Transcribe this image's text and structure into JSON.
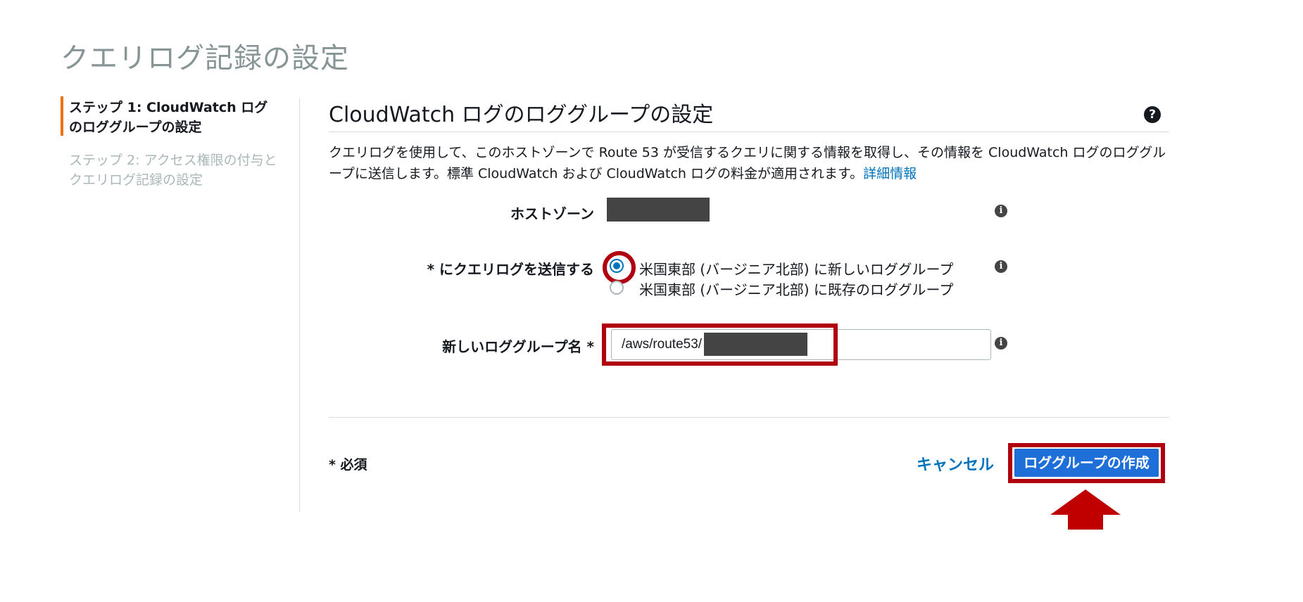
{
  "page": {
    "title": "クエリログ記録の設定"
  },
  "steps": [
    {
      "label": "ステップ 1: CloudWatch ログのロググループの設定",
      "active": true
    },
    {
      "label": "ステップ 2: アクセス権限の付与とクエリログ記録の設定",
      "active": false
    }
  ],
  "section": {
    "title": "CloudWatch ログのロググループの設定",
    "description": "クエリログを使用して、このホストゾーンで Route 53 が受信するクエリに関する情報を取得し、その情報を CloudWatch ログのロググループに送信します。標準 CloudWatch および CloudWatch ログの料金が適用されます。",
    "link_text": "詳細情報"
  },
  "form": {
    "hosted_zone_label": "ホストゾーン",
    "send_label": "* にクエリログを送信する",
    "radio_options": [
      {
        "label": "米国東部 (バージニア北部) に新しいロググループ",
        "checked": true
      },
      {
        "label": "米国東部 (バージニア北部) に既存のロググループ",
        "checked": false
      }
    ],
    "log_group_name_label": "新しいロググループ名 *",
    "log_group_name_value": "/aws/route53/"
  },
  "footer": {
    "required_note": "* 必須",
    "cancel_label": "キャンセル",
    "create_label": "ロググループの作成"
  },
  "colors": {
    "accent": "#ec7211",
    "link": "#0073bb",
    "primary_button": "#1f6fd8",
    "highlight": "#b0000f"
  }
}
